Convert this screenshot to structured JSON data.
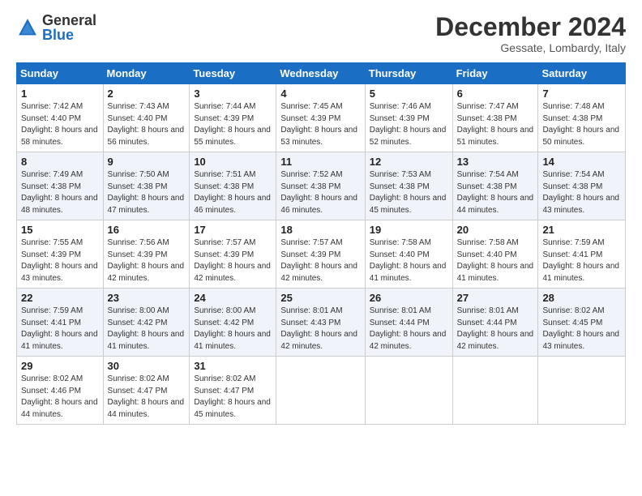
{
  "logo": {
    "general": "General",
    "blue": "Blue"
  },
  "header": {
    "month": "December 2024",
    "location": "Gessate, Lombardy, Italy"
  },
  "weekdays": [
    "Sunday",
    "Monday",
    "Tuesday",
    "Wednesday",
    "Thursday",
    "Friday",
    "Saturday"
  ],
  "weeks": [
    [
      {
        "day": "1",
        "sunrise": "7:42 AM",
        "sunset": "4:40 PM",
        "daylight": "8 hours and 58 minutes."
      },
      {
        "day": "2",
        "sunrise": "7:43 AM",
        "sunset": "4:40 PM",
        "daylight": "8 hours and 56 minutes."
      },
      {
        "day": "3",
        "sunrise": "7:44 AM",
        "sunset": "4:39 PM",
        "daylight": "8 hours and 55 minutes."
      },
      {
        "day": "4",
        "sunrise": "7:45 AM",
        "sunset": "4:39 PM",
        "daylight": "8 hours and 53 minutes."
      },
      {
        "day": "5",
        "sunrise": "7:46 AM",
        "sunset": "4:39 PM",
        "daylight": "8 hours and 52 minutes."
      },
      {
        "day": "6",
        "sunrise": "7:47 AM",
        "sunset": "4:38 PM",
        "daylight": "8 hours and 51 minutes."
      },
      {
        "day": "7",
        "sunrise": "7:48 AM",
        "sunset": "4:38 PM",
        "daylight": "8 hours and 50 minutes."
      }
    ],
    [
      {
        "day": "8",
        "sunrise": "7:49 AM",
        "sunset": "4:38 PM",
        "daylight": "8 hours and 48 minutes."
      },
      {
        "day": "9",
        "sunrise": "7:50 AM",
        "sunset": "4:38 PM",
        "daylight": "8 hours and 47 minutes."
      },
      {
        "day": "10",
        "sunrise": "7:51 AM",
        "sunset": "4:38 PM",
        "daylight": "8 hours and 46 minutes."
      },
      {
        "day": "11",
        "sunrise": "7:52 AM",
        "sunset": "4:38 PM",
        "daylight": "8 hours and 46 minutes."
      },
      {
        "day": "12",
        "sunrise": "7:53 AM",
        "sunset": "4:38 PM",
        "daylight": "8 hours and 45 minutes."
      },
      {
        "day": "13",
        "sunrise": "7:54 AM",
        "sunset": "4:38 PM",
        "daylight": "8 hours and 44 minutes."
      },
      {
        "day": "14",
        "sunrise": "7:54 AM",
        "sunset": "4:38 PM",
        "daylight": "8 hours and 43 minutes."
      }
    ],
    [
      {
        "day": "15",
        "sunrise": "7:55 AM",
        "sunset": "4:39 PM",
        "daylight": "8 hours and 43 minutes."
      },
      {
        "day": "16",
        "sunrise": "7:56 AM",
        "sunset": "4:39 PM",
        "daylight": "8 hours and 42 minutes."
      },
      {
        "day": "17",
        "sunrise": "7:57 AM",
        "sunset": "4:39 PM",
        "daylight": "8 hours and 42 minutes."
      },
      {
        "day": "18",
        "sunrise": "7:57 AM",
        "sunset": "4:39 PM",
        "daylight": "8 hours and 42 minutes."
      },
      {
        "day": "19",
        "sunrise": "7:58 AM",
        "sunset": "4:40 PM",
        "daylight": "8 hours and 41 minutes."
      },
      {
        "day": "20",
        "sunrise": "7:58 AM",
        "sunset": "4:40 PM",
        "daylight": "8 hours and 41 minutes."
      },
      {
        "day": "21",
        "sunrise": "7:59 AM",
        "sunset": "4:41 PM",
        "daylight": "8 hours and 41 minutes."
      }
    ],
    [
      {
        "day": "22",
        "sunrise": "7:59 AM",
        "sunset": "4:41 PM",
        "daylight": "8 hours and 41 minutes."
      },
      {
        "day": "23",
        "sunrise": "8:00 AM",
        "sunset": "4:42 PM",
        "daylight": "8 hours and 41 minutes."
      },
      {
        "day": "24",
        "sunrise": "8:00 AM",
        "sunset": "4:42 PM",
        "daylight": "8 hours and 41 minutes."
      },
      {
        "day": "25",
        "sunrise": "8:01 AM",
        "sunset": "4:43 PM",
        "daylight": "8 hours and 42 minutes."
      },
      {
        "day": "26",
        "sunrise": "8:01 AM",
        "sunset": "4:44 PM",
        "daylight": "8 hours and 42 minutes."
      },
      {
        "day": "27",
        "sunrise": "8:01 AM",
        "sunset": "4:44 PM",
        "daylight": "8 hours and 42 minutes."
      },
      {
        "day": "28",
        "sunrise": "8:02 AM",
        "sunset": "4:45 PM",
        "daylight": "8 hours and 43 minutes."
      }
    ],
    [
      {
        "day": "29",
        "sunrise": "8:02 AM",
        "sunset": "4:46 PM",
        "daylight": "8 hours and 44 minutes."
      },
      {
        "day": "30",
        "sunrise": "8:02 AM",
        "sunset": "4:47 PM",
        "daylight": "8 hours and 44 minutes."
      },
      {
        "day": "31",
        "sunrise": "8:02 AM",
        "sunset": "4:47 PM",
        "daylight": "8 hours and 45 minutes."
      },
      null,
      null,
      null,
      null
    ]
  ]
}
